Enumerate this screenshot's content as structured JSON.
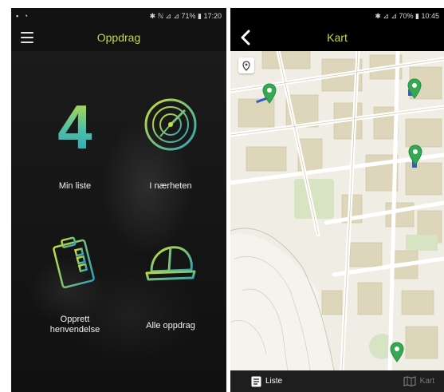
{
  "colors": {
    "accent_green": "#c3da3b",
    "accent_teal": "#2aa2b8",
    "marker_green": "#35a853",
    "dark_bg": "#121212"
  },
  "left_screen": {
    "status": {
      "left_icons": "▪ ◔",
      "right": "✱ ℕ ⊿ ⊿ 71% ▮ 17:20"
    },
    "title": "Oppdrag",
    "tiles": {
      "my_list": {
        "count": "4",
        "label": "Min liste"
      },
      "nearby": {
        "label": "I nærheten",
        "icon": "radar-icon"
      },
      "create": {
        "label_line1": "Opprett",
        "label_line2": "henvendelse",
        "icon": "clipboard-icon"
      },
      "all": {
        "label": "Alle oppdrag",
        "icon": "hard-hat-icon"
      }
    }
  },
  "right_screen": {
    "status": {
      "right": "✱ ⊿ ⊿ 70% ▮ 10:45"
    },
    "title": "Kart",
    "bottom_nav": {
      "list_label": "Liste",
      "map_label": "Kart"
    }
  }
}
